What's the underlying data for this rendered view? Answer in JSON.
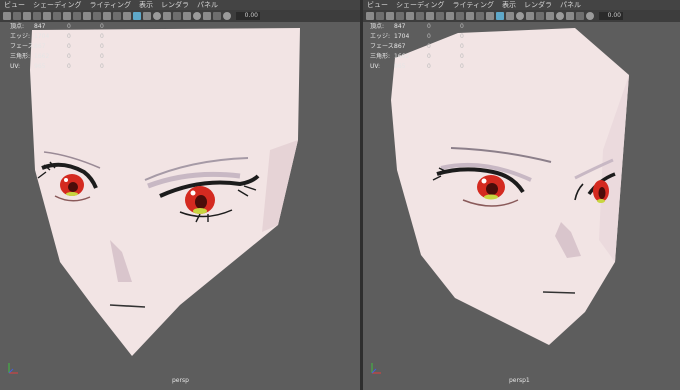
{
  "menu": [
    "ビュー",
    "シェーディング",
    "ライティング",
    "表示",
    "レンダラ",
    "パネル"
  ],
  "toolbar": {
    "value": "0.00"
  },
  "hud_left": [
    {
      "label": "頂点:",
      "c1": "847",
      "c2": "0",
      "c3": "0"
    },
    {
      "label": "エッジ:",
      "c1": "1704",
      "c2": "0",
      "c3": "0"
    },
    {
      "label": "フェース:",
      "c1": "867",
      "c2": "0",
      "c3": "0"
    },
    {
      "label": "三角形:",
      "c1": "1662",
      "c2": "0",
      "c3": "0"
    },
    {
      "label": "UV:",
      "c1": "965",
      "c2": "0",
      "c3": "0"
    }
  ],
  "hud_right": [
    {
      "label": "頂点:",
      "c1": "847",
      "c2": "0",
      "c3": "0"
    },
    {
      "label": "エッジ:",
      "c1": "1704",
      "c2": "0",
      "c3": "0"
    },
    {
      "label": "フェース:",
      "c1": "867",
      "c2": "0",
      "c3": "0"
    },
    {
      "label": "三角形:",
      "c1": "1662",
      "c2": "0",
      "c3": "0"
    },
    {
      "label": "UV:",
      "c1": "965",
      "c2": "0",
      "c3": "0"
    }
  ],
  "camera_left": "persp",
  "camera_right": "persp1",
  "colors": {
    "viewport_bg": "#5d5d5d",
    "menubar": "#444444",
    "toolbar": "#3d3d3d",
    "skin": "#f2e4e4",
    "iris": "#d42a20",
    "highlight": "#5ea7c8"
  }
}
